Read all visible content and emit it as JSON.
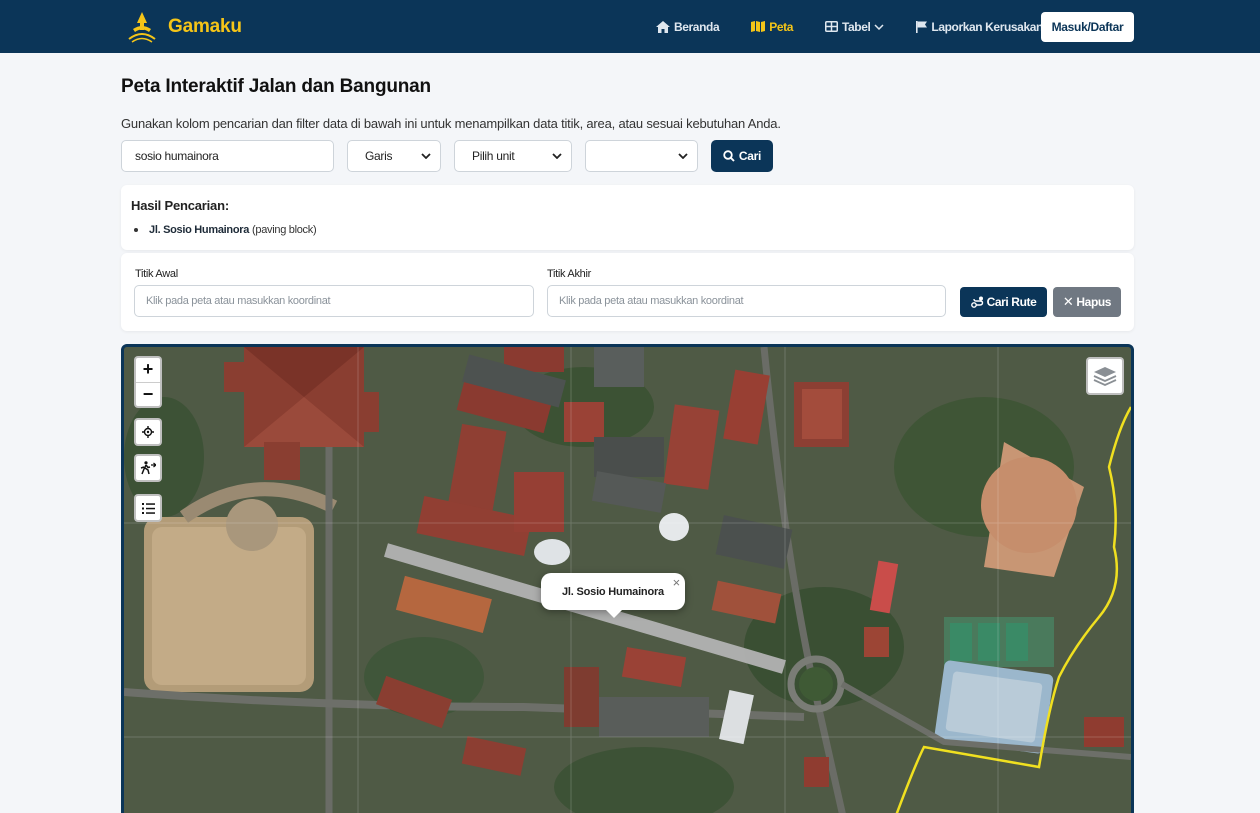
{
  "brand": {
    "name": "Gamaku"
  },
  "nav": {
    "home": "Beranda",
    "map": "Peta",
    "table": "Tabel",
    "report": "Laporkan Kerusakan",
    "login": "Masuk/Daftar"
  },
  "header": {
    "title": "Peta Interaktif Jalan dan Bangunan",
    "description": "Gunakan kolom pencarian dan filter data di bawah ini untuk menampilkan data titik, area, atau sesuai kebutuhan Anda."
  },
  "search": {
    "query": "sosio humainora",
    "type_select": "Garis",
    "unit_select": "Pilih unit",
    "third_select": "",
    "button": "Cari"
  },
  "results": {
    "title": "Hasil Pencarian:",
    "items": [
      {
        "name": "Jl. Sosio Humainora",
        "detail": "(paving block)"
      }
    ]
  },
  "route": {
    "start_label": "Titik Awal",
    "start_placeholder": "Klik pada peta atau masukkan koordinat",
    "end_label": "Titik Akhir",
    "end_placeholder": "Klik pada peta atau masukkan koordinat",
    "find_button": "Cari Rute",
    "clear_button": "Hapus"
  },
  "map": {
    "popup_label": "Jl. Sosio Humainora",
    "zoom_in": "+",
    "zoom_out": "−",
    "accent_color": "#0b3558",
    "highlight_color": "#f5c518"
  }
}
